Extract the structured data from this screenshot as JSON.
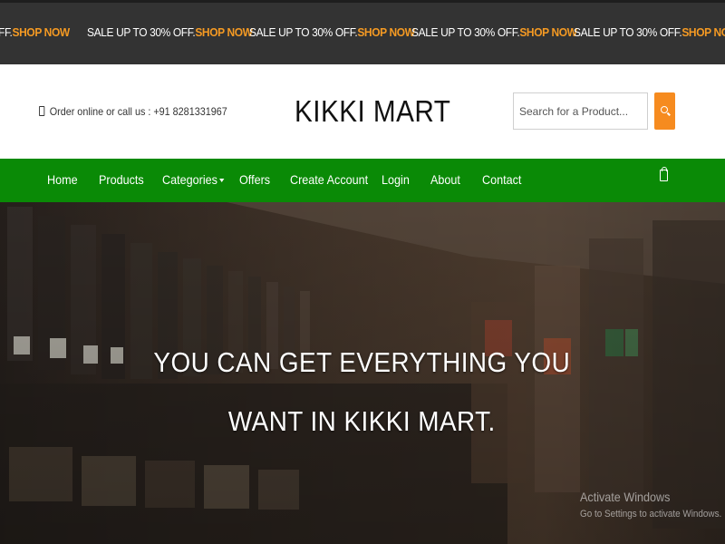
{
  "ticker": {
    "sale_text": "SALE UP TO 30% OFF.",
    "link_text": "SHOP NOW",
    "first_partial_sale": "FF.",
    "colors": {
      "background": "#333333",
      "link": "#f59a23"
    }
  },
  "header": {
    "contact_text": "Order online or call us : +91 8281331967",
    "brand": "KIKKI MART",
    "search": {
      "placeholder": "Search for a Product...",
      "button_icon": "search-icon"
    },
    "colors": {
      "search_button": "#f68b1f"
    }
  },
  "nav": {
    "items": [
      {
        "label": "Home"
      },
      {
        "label": "Products"
      },
      {
        "label": "Categories"
      },
      {
        "label": "Offers"
      },
      {
        "label": "Create Account"
      },
      {
        "label": "Login"
      },
      {
        "label": "About"
      },
      {
        "label": "Contact"
      }
    ],
    "cart_icon": "shopping-bag-icon",
    "colors": {
      "background": "#0a8a06"
    }
  },
  "hero": {
    "line1": "YOU CAN GET EVERYTHING YOU",
    "line2": "WANT IN KIKKI MART."
  },
  "watermark": {
    "title": "Activate Windows",
    "subtitle": "Go to Settings to activate Windows."
  }
}
